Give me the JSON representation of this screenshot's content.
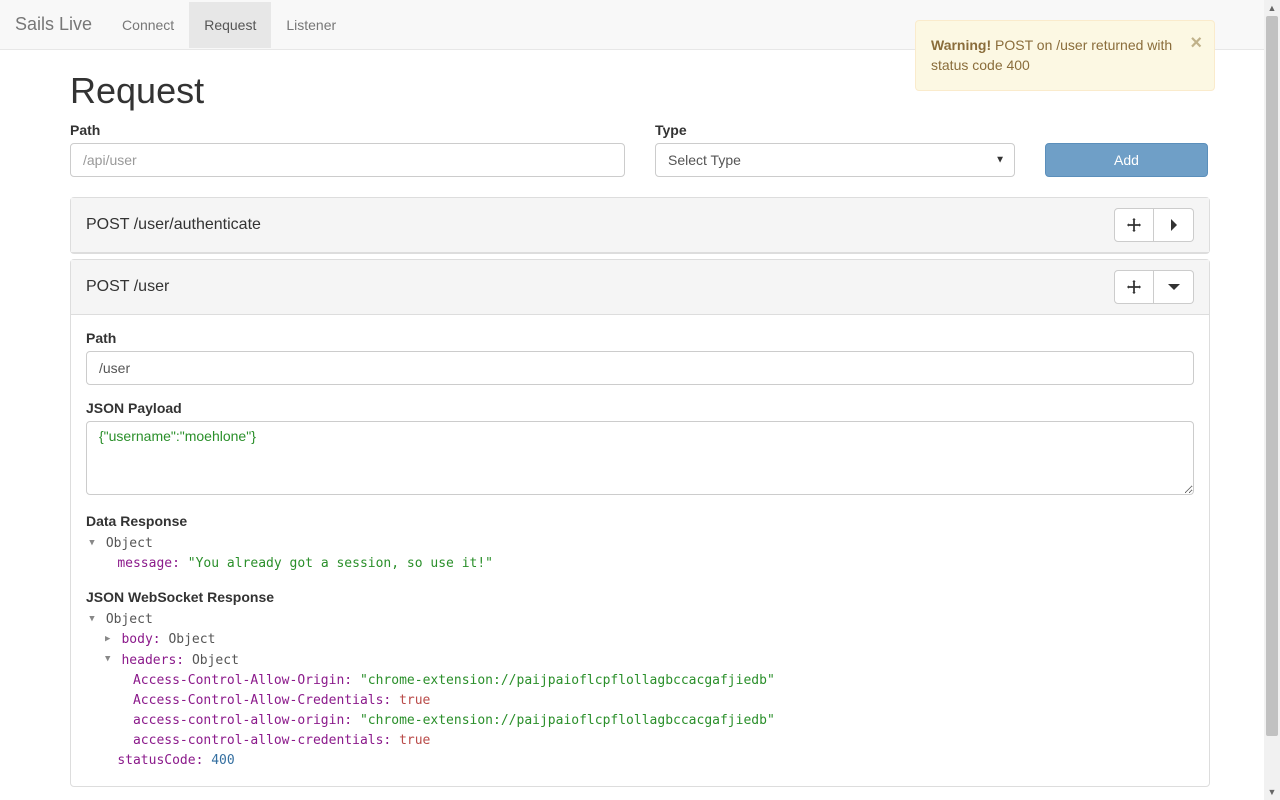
{
  "brand": "Sails Live",
  "nav": {
    "connect": "Connect",
    "request": "Request",
    "listener": "Listener"
  },
  "alert": {
    "strong": "Warning!",
    "text": " POST on /user returned with status code 400"
  },
  "page_title": "Request",
  "form": {
    "path_label": "Path",
    "path_placeholder": "/api/user",
    "type_label": "Type",
    "type_selected": "Select Type",
    "add_label": "Add"
  },
  "cards": {
    "card0_title": "POST /user/authenticate",
    "card1_title": "POST /user"
  },
  "detail": {
    "path_label": "Path",
    "path_value": "/user",
    "payload_label": "JSON Payload",
    "payload_value": "{\"username\":\"moehlone\"}",
    "data_response_label": "Data Response",
    "ws_response_label": "JSON WebSocket Response"
  },
  "data_response": {
    "object_label": "Object",
    "message_key": "message: ",
    "message_val": "\"You already got a session, so use it!\""
  },
  "ws_response": {
    "object_label": "Object",
    "body_key": "body: ",
    "body_val": "Object",
    "headers_key": "headers: ",
    "headers_val": "Object",
    "h1_key": "Access-Control-Allow-Origin: ",
    "h1_val": "\"chrome-extension://paijpaioflcpflollagbccacgafjiedb\"",
    "h2_key": "Access-Control-Allow-Credentials: ",
    "h2_val": "true",
    "h3_key": "access-control-allow-origin: ",
    "h3_val": "\"chrome-extension://paijpaioflcpflollagbccacgafjiedb\"",
    "h4_key": "access-control-allow-credentials: ",
    "h4_val": "true",
    "status_key": "statusCode: ",
    "status_val": "400"
  }
}
